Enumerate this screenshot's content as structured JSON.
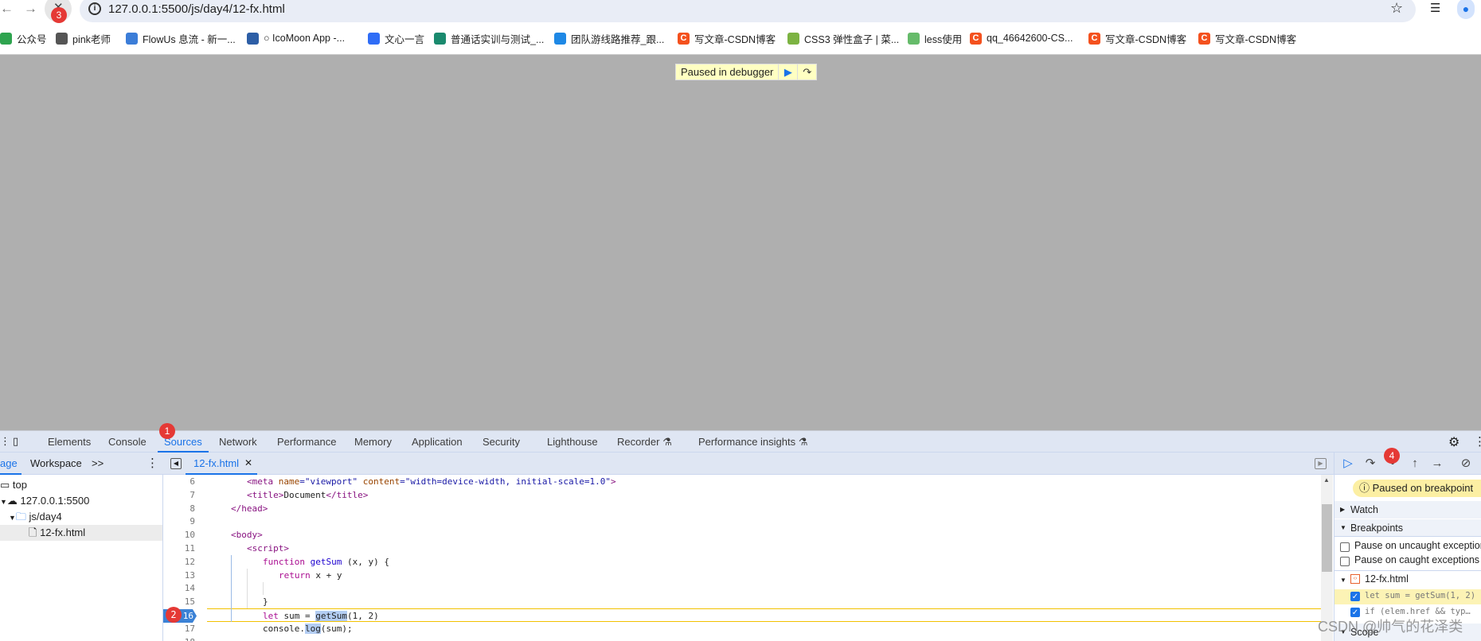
{
  "browser": {
    "url": "127.0.0.1:5500/js/day4/12-fx.html",
    "bookmarks": [
      {
        "label": "公众号",
        "icon": "wechat-icon",
        "color": "#2ea44f"
      },
      {
        "label": "pink老师",
        "icon": "folder-icon",
        "color": "#555555"
      },
      {
        "label": "FlowUs 息流 - 新一...",
        "icon": "flowus-icon",
        "color": "#3b7dd8"
      },
      {
        "label": "○ IcoMoon App -...",
        "icon": "icomoon-icon",
        "color": "#2d5ea6"
      },
      {
        "label": "文心一言",
        "icon": "wenxin-icon",
        "color": "#2f6df6"
      },
      {
        "label": "普通话实训与测试_...",
        "icon": "putonghua-icon",
        "color": "#1a8a6e"
      },
      {
        "label": "团队游线路推荐_跟...",
        "icon": "travel-icon",
        "color": "#1e88e5"
      },
      {
        "label": "写文章-CSDN博客",
        "icon": "csdn-icon",
        "color": "#f4511e"
      },
      {
        "label": "CSS3 弹性盒子 | 菜...",
        "icon": "runoob-icon",
        "color": "#7cb342"
      },
      {
        "label": "less使用",
        "icon": "less-icon",
        "color": "#66bb6a"
      },
      {
        "label": "qq_46642600-CS...",
        "icon": "csdn-icon",
        "color": "#f4511e"
      },
      {
        "label": "写文章-CSDN博客",
        "icon": "csdn-icon",
        "color": "#f4511e"
      },
      {
        "label": "写文章-CSDN博客",
        "icon": "csdn-icon",
        "color": "#f4511e"
      }
    ],
    "badge3": "3"
  },
  "page": {
    "paused_text": "Paused in debugger"
  },
  "devtools": {
    "tabs": [
      "Elements",
      "Console",
      "Sources",
      "Network",
      "Performance",
      "Memory",
      "Application",
      "Security",
      "Lighthouse",
      "Recorder",
      "Performance insights"
    ],
    "active_tab": "Sources",
    "badge1": "1",
    "navigator_tabs": {
      "page": "age",
      "workspace": "Workspace",
      "more": ">>"
    },
    "tree": {
      "top": "top",
      "host": "127.0.0.1:5500",
      "folder": "js/day4",
      "file": "12-fx.html"
    },
    "editor_tab": "12-fx.html",
    "badge2": "2",
    "badge4": "4",
    "breakpoint_line": 16,
    "code": [
      {
        "n": 6,
        "indent": 2,
        "tokens": [
          {
            "t": "<meta ",
            "k": "tag"
          },
          {
            "t": "name",
            "k": "attr"
          },
          {
            "t": "=\"viewport\" ",
            "k": "str"
          },
          {
            "t": "content",
            "k": "attr"
          },
          {
            "t": "=\"width=device-width, initial-scale=1.0\"",
            "k": "str"
          },
          {
            "t": ">",
            "k": "tag"
          }
        ]
      },
      {
        "n": 7,
        "indent": 2,
        "tokens": [
          {
            "t": "<title>",
            "k": "tag"
          },
          {
            "t": "Document",
            "k": "plain"
          },
          {
            "t": "</title>",
            "k": "tag"
          }
        ]
      },
      {
        "n": 8,
        "indent": 0,
        "tokens": [
          {
            "t": "</head>",
            "k": "tag"
          }
        ]
      },
      {
        "n": 9,
        "indent": 0,
        "tokens": []
      },
      {
        "n": 10,
        "indent": 0,
        "tokens": [
          {
            "t": "<body>",
            "k": "tag"
          }
        ]
      },
      {
        "n": 11,
        "indent": 2,
        "tokens": [
          {
            "t": "<script>",
            "k": "tag"
          }
        ]
      },
      {
        "n": 12,
        "indent": 4,
        "tokens": [
          {
            "t": "function ",
            "k": "kw"
          },
          {
            "t": "getSum ",
            "k": "fn"
          },
          {
            "t": "(x, y) {",
            "k": "plain"
          }
        ]
      },
      {
        "n": 13,
        "indent": 6,
        "tokens": [
          {
            "t": "return ",
            "k": "kw"
          },
          {
            "t": "x + y",
            "k": "plain"
          }
        ]
      },
      {
        "n": 14,
        "indent": 0,
        "tokens": []
      },
      {
        "n": 15,
        "indent": 4,
        "tokens": [
          {
            "t": "}",
            "k": "plain"
          }
        ]
      },
      {
        "n": 16,
        "indent": 4,
        "tokens": [
          {
            "t": "let ",
            "k": "kw"
          },
          {
            "t": "sum = ",
            "k": "plain"
          },
          {
            "t": "getSum",
            "k": "sel"
          },
          {
            "t": "(1, 2)",
            "k": "plain"
          }
        ]
      },
      {
        "n": 17,
        "indent": 4,
        "tokens": [
          {
            "t": "console.",
            "k": "plain"
          },
          {
            "t": "log",
            "k": "sel"
          },
          {
            "t": "(sum);",
            "k": "plain"
          }
        ]
      },
      {
        "n": 18,
        "indent": 0,
        "tokens": []
      }
    ],
    "debugger": {
      "status": "Paused on breakpoint",
      "watch": "Watch",
      "breakpoints": "Breakpoints",
      "pause_uncaught": "Pause on uncaught exceptions",
      "pause_caught": "Pause on caught exceptions",
      "bp_file": "12-fx.html",
      "bp1": "let sum = getSum(1, 2)",
      "bp2": "if (elem.href && typ…",
      "scope": "Scope"
    }
  },
  "watermark": "CSDN @帅气的花泽类"
}
